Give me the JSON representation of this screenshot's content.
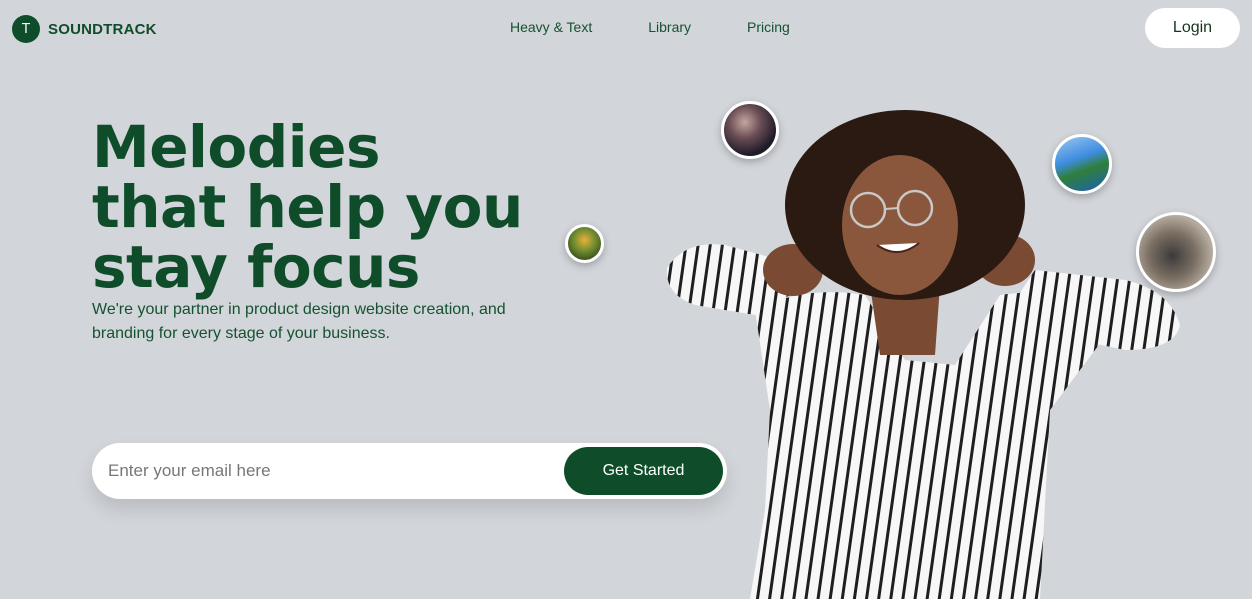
{
  "brand": {
    "logo_letter": "T",
    "name": "SOUNDTRACK"
  },
  "nav": {
    "items": [
      "Heavy & Text",
      "Library",
      "Pricing"
    ]
  },
  "header": {
    "login_label": "Login"
  },
  "hero": {
    "title_lines": [
      "Melodies",
      "that help you",
      "stay focus"
    ],
    "subtitle": "We're your partner in product design website creation, and branding for every stage of your business."
  },
  "signup": {
    "email_placeholder": "Enter your email here",
    "email_value": "",
    "cta_label": "Get Started"
  },
  "colors": {
    "brand_green": "#0f4d2a",
    "background": "#d2d5da"
  }
}
